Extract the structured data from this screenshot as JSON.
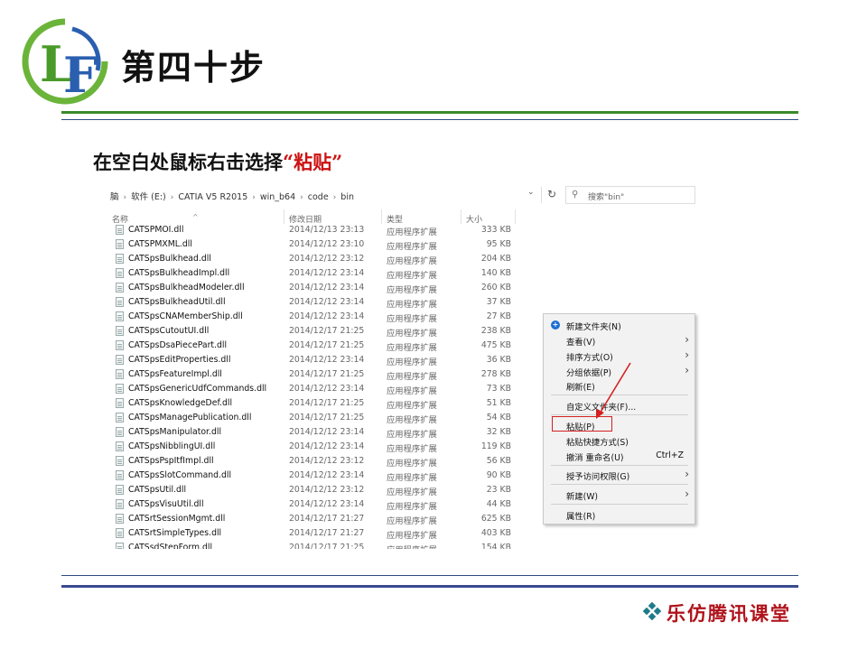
{
  "slide": {
    "logo_text": "LF",
    "title": "第四十步",
    "instruction_prefix": "在空白处鼠标右击选择",
    "instruction_highlight": "“粘贴”",
    "brand": "乐仿腾讯课堂"
  },
  "explorer": {
    "breadcrumbs": [
      "脑",
      "软件 (E:)",
      "CATIA V5 R2015",
      "win_b64",
      "code",
      "bin"
    ],
    "search_placeholder": "搜索\"bin\"",
    "columns": {
      "name": "名称",
      "modified": "修改日期",
      "type": "类型",
      "size": "大小"
    },
    "files": [
      {
        "name": "CATSPMOI.dll",
        "modified": "2014/12/13 23:13",
        "type": "应用程序扩展",
        "size": "333 KB"
      },
      {
        "name": "CATSPMXML.dll",
        "modified": "2014/12/12 23:10",
        "type": "应用程序扩展",
        "size": "95 KB"
      },
      {
        "name": "CATSpsBulkhead.dll",
        "modified": "2014/12/12 23:12",
        "type": "应用程序扩展",
        "size": "204 KB"
      },
      {
        "name": "CATSpsBulkheadImpl.dll",
        "modified": "2014/12/12 23:14",
        "type": "应用程序扩展",
        "size": "140 KB"
      },
      {
        "name": "CATSpsBulkheadModeler.dll",
        "modified": "2014/12/12 23:14",
        "type": "应用程序扩展",
        "size": "260 KB"
      },
      {
        "name": "CATSpsBulkheadUtil.dll",
        "modified": "2014/12/12 23:14",
        "type": "应用程序扩展",
        "size": "37 KB"
      },
      {
        "name": "CATSpsCNAMemberShip.dll",
        "modified": "2014/12/12 23:14",
        "type": "应用程序扩展",
        "size": "27 KB"
      },
      {
        "name": "CATSpsCutoutUI.dll",
        "modified": "2014/12/17 21:25",
        "type": "应用程序扩展",
        "size": "238 KB"
      },
      {
        "name": "CATSpsDsaPiecePart.dll",
        "modified": "2014/12/17 21:25",
        "type": "应用程序扩展",
        "size": "475 KB"
      },
      {
        "name": "CATSpsEditProperties.dll",
        "modified": "2014/12/12 23:14",
        "type": "应用程序扩展",
        "size": "36 KB"
      },
      {
        "name": "CATSpsFeatureImpl.dll",
        "modified": "2014/12/17 21:25",
        "type": "应用程序扩展",
        "size": "278 KB"
      },
      {
        "name": "CATSpsGenericUdfCommands.dll",
        "modified": "2014/12/12 23:14",
        "type": "应用程序扩展",
        "size": "73 KB"
      },
      {
        "name": "CATSpsKnowledgeDef.dll",
        "modified": "2014/12/17 21:25",
        "type": "应用程序扩展",
        "size": "51 KB"
      },
      {
        "name": "CATSpsManagePublication.dll",
        "modified": "2014/12/17 21:25",
        "type": "应用程序扩展",
        "size": "54 KB"
      },
      {
        "name": "CATSpsManipulator.dll",
        "modified": "2014/12/12 23:14",
        "type": "应用程序扩展",
        "size": "32 KB"
      },
      {
        "name": "CATSpsNibblingUI.dll",
        "modified": "2014/12/12 23:14",
        "type": "应用程序扩展",
        "size": "119 KB"
      },
      {
        "name": "CATSpsPspItfImpl.dll",
        "modified": "2014/12/12 23:12",
        "type": "应用程序扩展",
        "size": "56 KB"
      },
      {
        "name": "CATSpsSlotCommand.dll",
        "modified": "2014/12/12 23:14",
        "type": "应用程序扩展",
        "size": "90 KB"
      },
      {
        "name": "CATSpsUtil.dll",
        "modified": "2014/12/12 23:12",
        "type": "应用程序扩展",
        "size": "23 KB"
      },
      {
        "name": "CATSpsVisuUtil.dll",
        "modified": "2014/12/12 23:14",
        "type": "应用程序扩展",
        "size": "44 KB"
      },
      {
        "name": "CATSrtSessionMgmt.dll",
        "modified": "2014/12/17 21:27",
        "type": "应用程序扩展",
        "size": "625 KB"
      },
      {
        "name": "CATSrtSimpleTypes.dll",
        "modified": "2014/12/17 21:27",
        "type": "应用程序扩展",
        "size": "403 KB"
      },
      {
        "name": "CATSsdStepForm.dll",
        "modified": "2014/12/17 21:25",
        "type": "应用程序扩展",
        "size": "154 KB"
      }
    ]
  },
  "context_menu": {
    "new_folder": "新建文件夹(N)",
    "view": "查看(V)",
    "sort_by": "排序方式(O)",
    "group_by": "分组依据(P)",
    "refresh": "刷新(E)",
    "customize_folder": "自定义文件夹(F)...",
    "paste": "粘贴(P)",
    "paste_shortcut": "粘贴快捷方式(S)",
    "undo_rename": "撤消 重命名(U)",
    "undo_shortcut": "Ctrl+Z",
    "grant_access": "授予访问权限(G)",
    "new": "新建(W)",
    "properties": "属性(R)"
  },
  "colors": {
    "accent_green": "#3a8a2c",
    "rule_blue": "#2c4a80",
    "highlight_red": "#cc1111"
  }
}
